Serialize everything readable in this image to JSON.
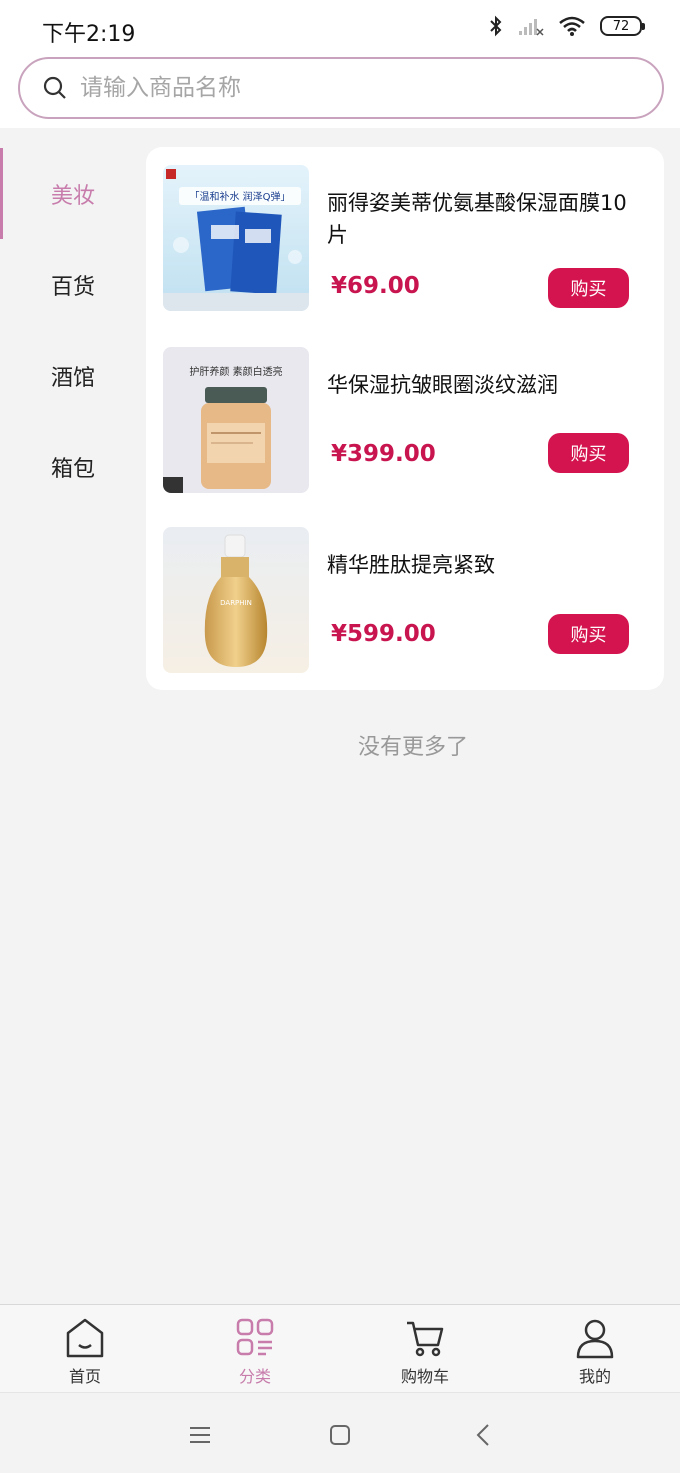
{
  "status_bar": {
    "time": "下午2:19",
    "battery": "72"
  },
  "search": {
    "placeholder": "请输入商品名称"
  },
  "sidebar": {
    "items": [
      {
        "label": "美妆"
      },
      {
        "label": "百货"
      },
      {
        "label": "酒馆"
      },
      {
        "label": "箱包"
      }
    ]
  },
  "products": [
    {
      "name": "丽得姿美蒂优氨基酸保湿面膜10片",
      "price": "¥69.00",
      "buy_label": "购买",
      "image_text": "「温和补水 润泽Q弹」"
    },
    {
      "name": "华保湿抗皱眼圈淡纹滋润",
      "price": "¥399.00",
      "buy_label": "购买",
      "image_text": "护肝养颜 素颜白透亮"
    },
    {
      "name": "精华胜肽提亮紧致",
      "price": "¥599.00",
      "buy_label": "购买",
      "image_text": "DARPHIN"
    }
  ],
  "footer_text": "没有更多了",
  "tab_bar": {
    "tabs": [
      {
        "label": "首页"
      },
      {
        "label": "分类"
      },
      {
        "label": "购物车"
      },
      {
        "label": "我的"
      }
    ]
  },
  "colors": {
    "accent": "#c77cab",
    "price": "#c8144f",
    "buy_button": "#d3144f"
  }
}
